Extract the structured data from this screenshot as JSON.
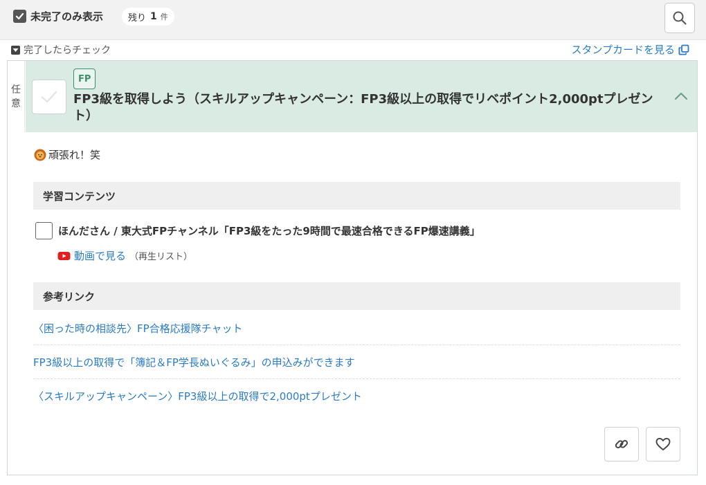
{
  "filter": {
    "label": "未完了のみ表示",
    "remaining_prefix": "残り",
    "remaining_count": "1",
    "remaining_unit": "件"
  },
  "hint": {
    "label": "完了したらチェック"
  },
  "stamp_card": {
    "label": "スタンプカードを見る"
  },
  "task": {
    "optional_label_1": "任",
    "optional_label_2": "意",
    "tag": "FP",
    "title": "FP3級を取得しよう（スキルアップキャンペーン：FP3級以上の取得でリベポイント2,000ptプレゼント）",
    "memo": "頑張れ！笑"
  },
  "learning": {
    "heading": "学習コンテンツ",
    "item_title": "ほんださん / 東大式FPチャンネル「FP3級をたった9時間で最速合格できるFP爆速講義」",
    "video_link": "動画で見る",
    "video_note": "（再生リスト）"
  },
  "references": {
    "heading": "参考リンク",
    "links": [
      "〈困った時の相談先〉FP合格応援隊チャット",
      "FP3級以上の取得で「簿記＆FP学長ぬいぐるみ」の申込みができます",
      "〈スキルアップキャンペーン〉FP3級以上の取得で2,000ptプレゼント"
    ]
  },
  "colors": {
    "accent": "#2a7bc4",
    "header_bg": "#d9ebe2",
    "tag_green": "#3e8f68",
    "youtube_red": "#e02020"
  },
  "icons": {
    "filter_check": "checkmark-icon",
    "search": "search-icon",
    "hint": "caret-down-icon",
    "stamp_card": "external-window-icon",
    "collapse": "chevron-up-icon",
    "memo": "lion-emoji-icon",
    "video": "youtube-icon",
    "copy_link": "link-icon",
    "favorite": "heart-icon"
  }
}
